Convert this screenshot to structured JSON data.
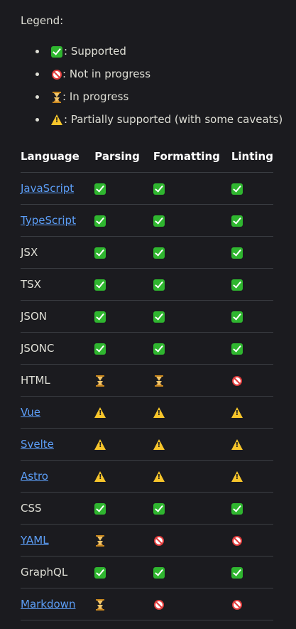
{
  "legend": {
    "title": "Legend:",
    "items": [
      {
        "icon": "check-icon",
        "text": ": Supported"
      },
      {
        "icon": "no-entry-icon",
        "text": ": Not in progress"
      },
      {
        "icon": "hourglass-icon",
        "text": ": In progress"
      },
      {
        "icon": "warning-icon",
        "text": ": Partially supported (with some caveats)"
      }
    ]
  },
  "table": {
    "headers": [
      "Language",
      "Parsing",
      "Formatting",
      "Linting"
    ],
    "rows": [
      {
        "language": "JavaScript",
        "link": true,
        "parsing": "supported",
        "formatting": "supported",
        "linting": "supported"
      },
      {
        "language": "TypeScript",
        "link": true,
        "parsing": "supported",
        "formatting": "supported",
        "linting": "supported"
      },
      {
        "language": "JSX",
        "link": false,
        "parsing": "supported",
        "formatting": "supported",
        "linting": "supported"
      },
      {
        "language": "TSX",
        "link": false,
        "parsing": "supported",
        "formatting": "supported",
        "linting": "supported"
      },
      {
        "language": "JSON",
        "link": false,
        "parsing": "supported",
        "formatting": "supported",
        "linting": "supported"
      },
      {
        "language": "JSONC",
        "link": false,
        "parsing": "supported",
        "formatting": "supported",
        "linting": "supported"
      },
      {
        "language": "HTML",
        "link": false,
        "parsing": "in-progress",
        "formatting": "in-progress",
        "linting": "not-in-progress"
      },
      {
        "language": "Vue",
        "link": true,
        "parsing": "partial",
        "formatting": "partial",
        "linting": "partial"
      },
      {
        "language": "Svelte",
        "link": true,
        "parsing": "partial",
        "formatting": "partial",
        "linting": "partial"
      },
      {
        "language": "Astro",
        "link": true,
        "parsing": "partial",
        "formatting": "partial",
        "linting": "partial"
      },
      {
        "language": "CSS",
        "link": false,
        "parsing": "supported",
        "formatting": "supported",
        "linting": "supported"
      },
      {
        "language": "YAML",
        "link": true,
        "parsing": "in-progress",
        "formatting": "not-in-progress",
        "linting": "not-in-progress"
      },
      {
        "language": "GraphQL",
        "link": false,
        "parsing": "supported",
        "formatting": "supported",
        "linting": "supported"
      },
      {
        "language": "Markdown",
        "link": true,
        "parsing": "in-progress",
        "formatting": "not-in-progress",
        "linting": "not-in-progress"
      }
    ]
  },
  "colors": {
    "background": "#1b1b1f",
    "text": "#dfdfd6",
    "link": "#5c9ef7",
    "supported": "#2fb62f",
    "not_in_progress": "#e23b3b",
    "in_progress": "#c8871e",
    "partial": "#f7c52b"
  }
}
